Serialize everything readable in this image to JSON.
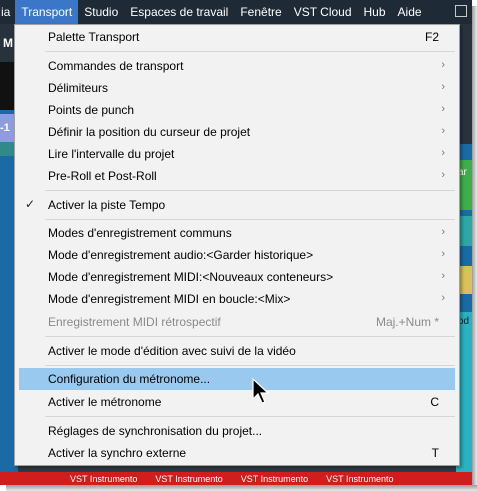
{
  "menubar": {
    "items": [
      {
        "label": "ia",
        "partial": true
      },
      {
        "label": "Transport",
        "active": true
      },
      {
        "label": "Studio"
      },
      {
        "label": "Espaces de travail"
      },
      {
        "label": "Fenêtre"
      },
      {
        "label": "VST Cloud"
      },
      {
        "label": "Hub"
      },
      {
        "label": "Aide"
      }
    ]
  },
  "background": {
    "left_letter": "M",
    "left_number": "-1",
    "right_top_text": "ar",
    "right_mid_text": "od",
    "bottom_labels": [
      "VST Instrumento",
      "VST Instrumento",
      "VST Instrumento",
      "VST Instrumento"
    ]
  },
  "transport_menu": {
    "items": [
      {
        "label": "Palette Transport",
        "shortcut": "F2"
      },
      {
        "separator": true
      },
      {
        "label": "Commandes de transport",
        "submenu": true
      },
      {
        "label": "Délimiteurs",
        "submenu": true
      },
      {
        "label": "Points de punch",
        "submenu": true
      },
      {
        "label": "Définir la position du curseur de projet",
        "submenu": true
      },
      {
        "label": "Lire l'intervalle du projet",
        "submenu": true
      },
      {
        "label": "Pre-Roll et Post-Roll",
        "submenu": true
      },
      {
        "separator": true
      },
      {
        "label": "Activer la piste Tempo",
        "checked": true
      },
      {
        "separator": true
      },
      {
        "label": "Modes d'enregistrement communs",
        "submenu": true
      },
      {
        "label": "Mode d'enregistrement audio:<Garder historique>",
        "submenu": true
      },
      {
        "label": "Mode d'enregistrement MIDI:<Nouveaux conteneurs>",
        "submenu": true
      },
      {
        "label": "Mode d'enregistrement MIDI en boucle:<Mix>",
        "submenu": true
      },
      {
        "label": "Enregistrement MIDI rétrospectif",
        "shortcut": "Maj.+Num *",
        "disabled": true
      },
      {
        "separator": true
      },
      {
        "label": "Activer le mode d'édition avec suivi de la vidéo"
      },
      {
        "separator": true
      },
      {
        "label": "Configuration du métronome...",
        "highlighted": true
      },
      {
        "label": "Activer le métronome",
        "shortcut": "C"
      },
      {
        "separator": true
      },
      {
        "label": "Réglages de synchronisation du projet..."
      },
      {
        "label": "Activer la synchro externe",
        "shortcut": "T"
      }
    ]
  },
  "colors": {
    "menubar_bg": "#1e2a35",
    "menubar_active": "#3a77c9",
    "menu_bg": "#f2f2f2",
    "menu_highlight": "#99c9ef",
    "disabled_text": "#8a8a8a",
    "track_red": "#d01e1e"
  }
}
